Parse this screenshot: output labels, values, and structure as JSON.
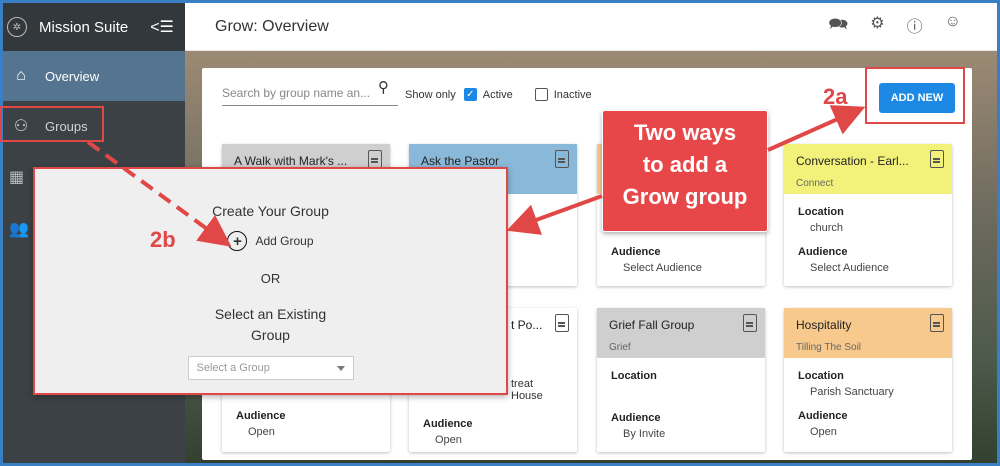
{
  "sidebar": {
    "app_title": "Mission Suite",
    "items": [
      {
        "label": "Overview",
        "icon": "home-icon"
      },
      {
        "label": "Groups",
        "icon": "groups-icon"
      }
    ]
  },
  "topbar": {
    "title": "Grow: Overview"
  },
  "toolbar": {
    "search_placeholder": "Search by group name an...",
    "show_only": "Show only",
    "active_label": "Active",
    "active_checked": true,
    "inactive_label": "Inactive",
    "inactive_checked": false,
    "add_new": "ADD NEW"
  },
  "cards": [
    {
      "name": "A Walk with Mark's ...",
      "color": "#cfcfcf"
    },
    {
      "name": "Ask the Pastor",
      "color": "#8ab8d8"
    },
    {
      "name": "",
      "color": "#f8c98d",
      "audience_label": "Audience",
      "audience": "Select Audience"
    },
    {
      "name": "Conversation - Earl...",
      "subtitle": "Connect",
      "color": "#f2f27a",
      "location_label": "Location",
      "location": "church",
      "audience_label": "Audience",
      "audience": "Select Audience"
    },
    {
      "name": "",
      "color": "#ffffff",
      "audience_label": "Audience",
      "audience": "Open"
    },
    {
      "name": "t Po...",
      "color": "#ffffff",
      "location_text": "treat House",
      "audience_label": "Audience",
      "audience": "Open"
    },
    {
      "name": "Grief Fall Group",
      "subtitle": "Grief",
      "color": "#cfcfcf",
      "location_label": "Location",
      "audience_label": "Audience",
      "audience": "By Invite"
    },
    {
      "name": "Hospitality",
      "subtitle": "Tilling The Soil",
      "color": "#f8c98d",
      "location_label": "Location",
      "location": "Parish Sanctuary",
      "audience_label": "Audience",
      "audience": "Open"
    }
  ],
  "modal": {
    "title": "Create Your Group",
    "add_group": "Add Group",
    "or": "OR",
    "select_existing_line1": "Select an Existing",
    "select_existing_line2": "Group",
    "select_placeholder": "Select a Group"
  },
  "annotations": {
    "callout": [
      "Two  ways",
      "to add a",
      "Grow group"
    ],
    "label_2a": "2a",
    "label_2b": "2b",
    "accent_color": "#e04848"
  }
}
